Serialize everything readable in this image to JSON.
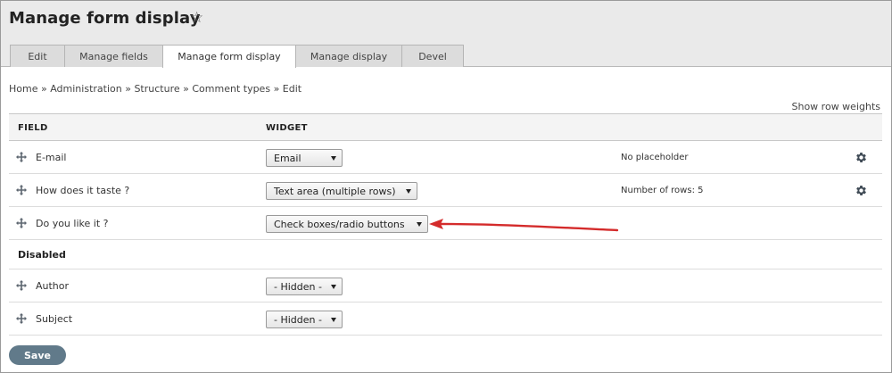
{
  "header": {
    "title": "Manage form display",
    "star_icon": "star-outline-icon"
  },
  "tabs": [
    {
      "label": "Edit",
      "active": false
    },
    {
      "label": "Manage fields",
      "active": false
    },
    {
      "label": "Manage form display",
      "active": true
    },
    {
      "label": "Manage display",
      "active": false
    },
    {
      "label": "Devel",
      "active": false
    }
  ],
  "breadcrumb": {
    "items": [
      "Home",
      "Administration",
      "Structure",
      "Comment types",
      "Edit"
    ],
    "separator": "»"
  },
  "show_row_weights": "Show row weights",
  "table": {
    "col_field": "FIELD",
    "col_widget": "WIDGET",
    "rows": [
      {
        "field": "E-mail",
        "widget": "Email",
        "summary": "No placeholder",
        "has_settings": true
      },
      {
        "field": "How does it taste ?",
        "widget": "Text area (multiple rows)",
        "summary": "Number of rows: 5",
        "has_settings": true
      },
      {
        "field": "Do you like it ?",
        "widget": "Check boxes/radio buttons",
        "summary": "",
        "has_settings": false
      }
    ],
    "disabled_label": "Disabled",
    "disabled_rows": [
      {
        "field": "Author",
        "widget": "- Hidden -"
      },
      {
        "field": "Subject",
        "widget": "- Hidden -"
      }
    ]
  },
  "save_label": "Save",
  "colors": {
    "header_bg": "#eaeaea",
    "save_button": "#617a8a",
    "annotation_arrow": "#d42b2b"
  },
  "icons": {
    "drag": "drag-handle-icon",
    "settings": "gear-icon",
    "dropdown": "chevron-down-icon"
  }
}
